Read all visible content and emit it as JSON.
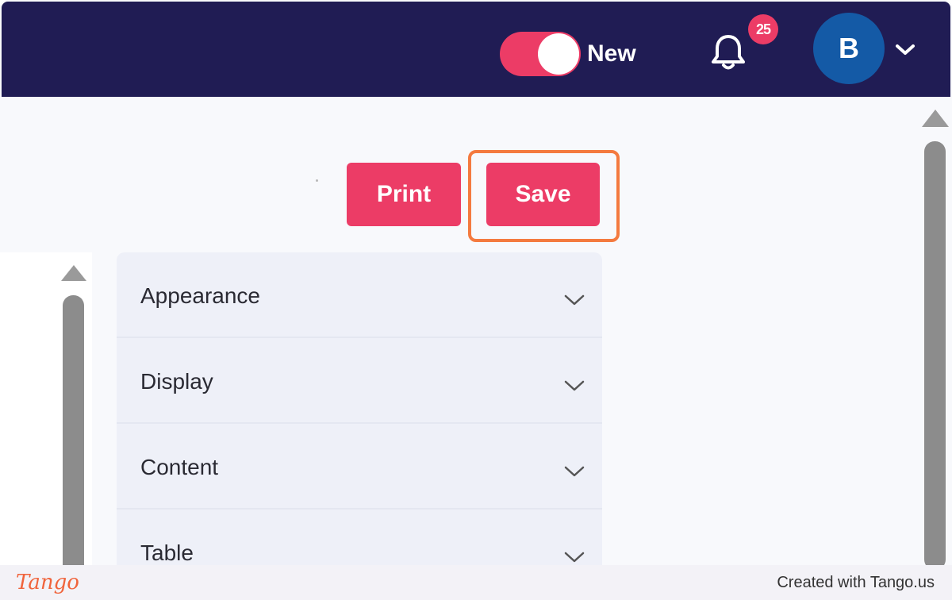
{
  "header": {
    "toggle_label": "New",
    "toggle_on": true,
    "notifications_count": "25",
    "avatar_initial": "B",
    "accent_color": "#ec3c66",
    "bar_color": "#201c54"
  },
  "actions": {
    "print_label": "Print",
    "save_label": "Save"
  },
  "accordion": {
    "items": [
      {
        "label": "Appearance"
      },
      {
        "label": "Display"
      },
      {
        "label": "Content"
      },
      {
        "label": "Table"
      }
    ]
  },
  "footer": {
    "logo_text": "Tango",
    "credit_text": "Created with Tango.us"
  }
}
